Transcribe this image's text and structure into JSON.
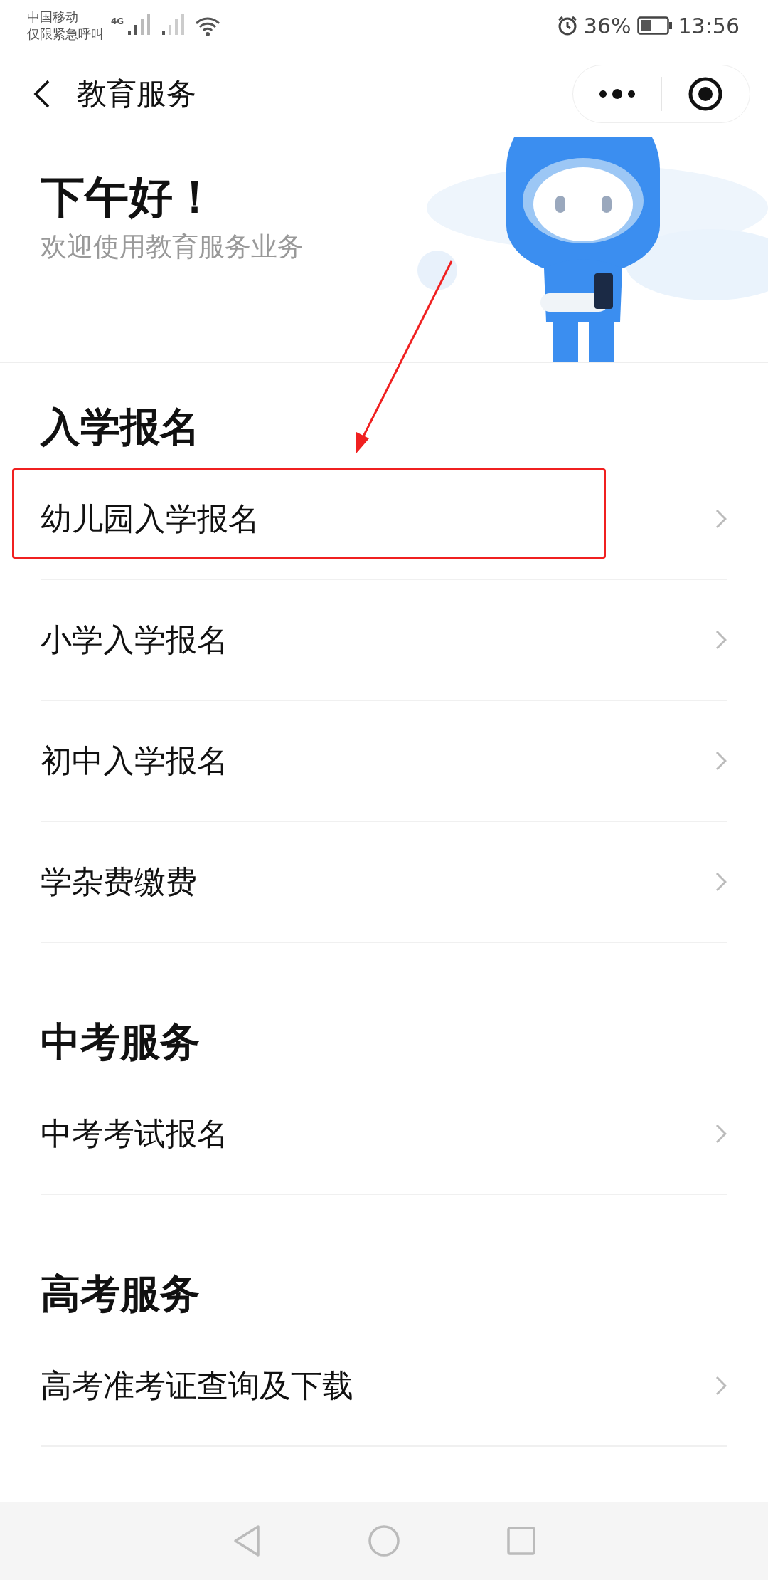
{
  "status_bar": {
    "carrier": "中国移动",
    "carrier_note": "仅限紧急呼叫",
    "network": "4G",
    "battery": "36%",
    "time": "13:56"
  },
  "nav": {
    "title": "教育服务"
  },
  "hero": {
    "greeting": "下午好！",
    "subtitle": "欢迎使用教育服务业务"
  },
  "sections": [
    {
      "title": "入学报名",
      "items": [
        {
          "label": "幼儿园入学报名",
          "annotated": true
        },
        {
          "label": "小学入学报名",
          "annotated": false
        },
        {
          "label": "初中入学报名",
          "annotated": false
        },
        {
          "label": "学杂费缴费",
          "annotated": false
        }
      ]
    },
    {
      "title": "中考服务",
      "items": [
        {
          "label": "中考考试报名",
          "annotated": false
        }
      ]
    },
    {
      "title": "高考服务",
      "items": [
        {
          "label": "高考准考证查询及下载",
          "annotated": false
        }
      ]
    }
  ]
}
